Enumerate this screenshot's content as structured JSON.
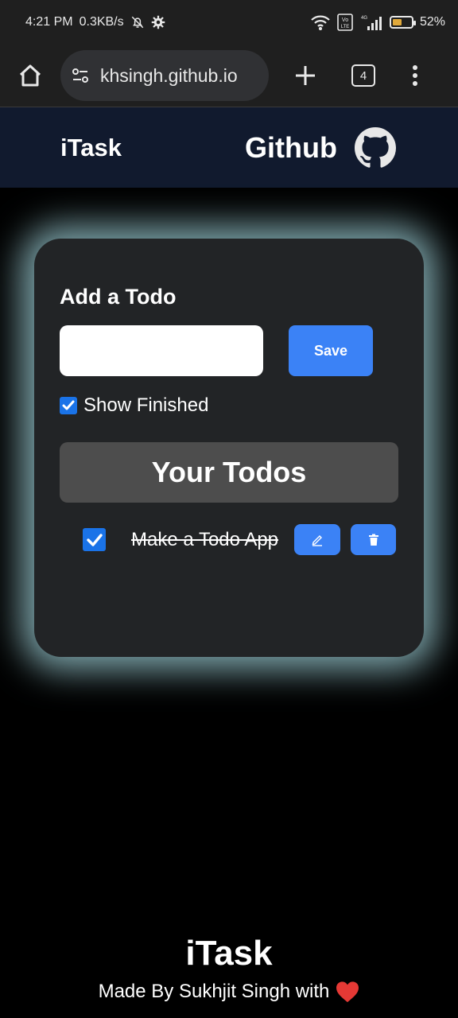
{
  "status_bar": {
    "time": "4:21 PM",
    "network_speed": "0.3KB/s",
    "network_type": "4G",
    "volte": "Vo LTE",
    "battery_percent": "52%",
    "battery_level": 0.52,
    "icons": [
      "bell-off-icon",
      "gear-icon",
      "wifi-icon",
      "volte-icon",
      "signal-icon",
      "battery-icon"
    ]
  },
  "browser": {
    "url": "khsingh.github.io",
    "tab_count": "4",
    "icons": [
      "home-icon",
      "site-settings-icon",
      "plus-icon",
      "tabs-icon",
      "menu-icon"
    ]
  },
  "nav": {
    "brand": "iTask",
    "github_label": "Github",
    "github_icon": "github-icon"
  },
  "card": {
    "add_title": "Add a Todo",
    "input_value": "",
    "input_placeholder": "",
    "save_label": "Save",
    "show_finished_label": "Show Finished",
    "show_finished_checked": true,
    "todos_title": "Your Todos",
    "todos": [
      {
        "text": "Make a Todo App",
        "completed": true
      }
    ]
  },
  "footer": {
    "brand": "iTask",
    "credit": "Made By Sukhjit Singh with"
  },
  "colors": {
    "accent": "#3b82f6",
    "checkbox": "#1a73e8",
    "nav_bg": "#111a2e",
    "card_bg": "#222426",
    "glow": "#b0e8f0",
    "header_bg": "#4d4d4d",
    "heart": "#e53935"
  }
}
